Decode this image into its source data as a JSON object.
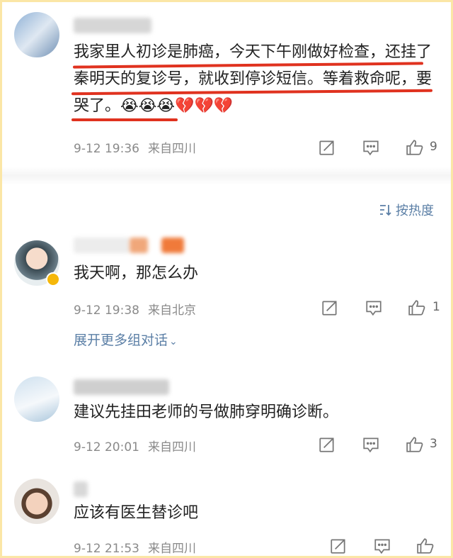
{
  "comments": [
    {
      "text": "我家里人初诊是肺癌，今天下午刚做好检查，还挂了秦明天的复诊号，就收到停诊短信。等着救命呢，要哭了。",
      "emoji": "😭😭😭💔💔💔",
      "time": "9-12 19:36",
      "location": "来自四川",
      "likes": "9"
    },
    {
      "text": "我天啊，那怎么办",
      "time": "9-12 19:38",
      "location": "来自北京",
      "likes": "1"
    },
    {
      "text": "建议先挂田老师的号做肺穿明确诊断。",
      "time": "9-12 20:01",
      "location": "来自四川",
      "likes": "3"
    },
    {
      "text": "应该有医生替诊吧",
      "time": "9-12 21:53",
      "location": "来自四川",
      "likes": ""
    }
  ],
  "sort_label": "按热度",
  "expand_label": "展开更多组对话",
  "colors": {
    "link": "#5b7fa6",
    "underline": "#e0321f",
    "frame": "#fbe6a6"
  }
}
